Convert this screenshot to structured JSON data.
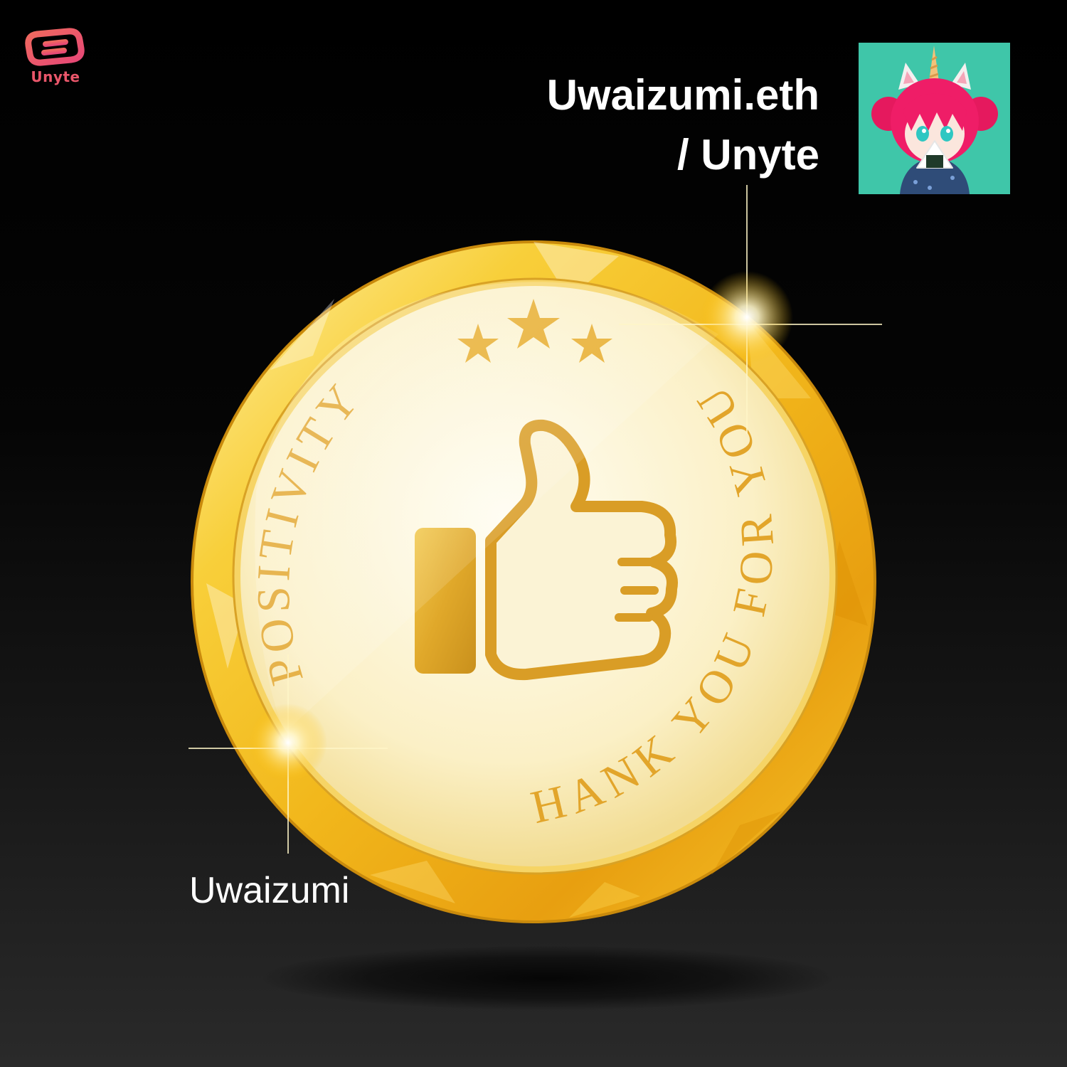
{
  "brand": {
    "name": "Unyte",
    "color": "#e9566a"
  },
  "header": {
    "title_line1": "Uwaizumi.eth",
    "title_line2": "/ Unyte"
  },
  "avatar": {
    "icon": "avatar-anime-character-icon",
    "bg_color": "#3fc6a9"
  },
  "coin": {
    "arc_right_text": "THANK YOU FOR YOUR",
    "arc_left_text": "POSITIVITY",
    "stars": 3,
    "center_icon": "thumbs-up-icon",
    "gold_color": "#f2b81c"
  },
  "owner": {
    "name": "Uwaizumi"
  }
}
